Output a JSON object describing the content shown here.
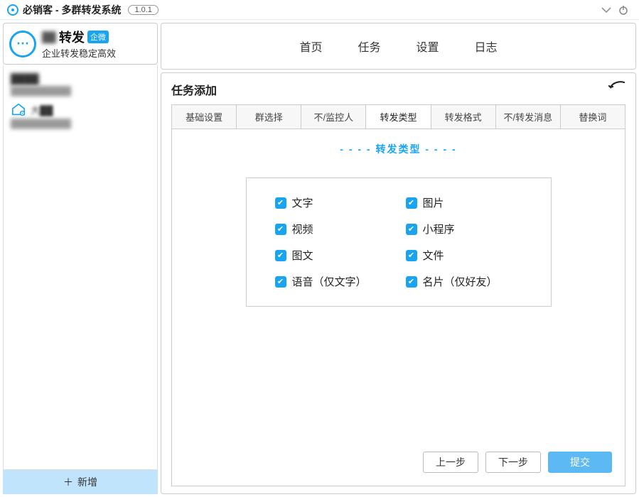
{
  "app": {
    "title": "必销客 - 多群转发系统",
    "version": "1.0.1"
  },
  "brand": {
    "main": "转发",
    "badge": "企微",
    "sub": "企业转发稳定高效"
  },
  "account": {
    "name": "████",
    "line": "██████████",
    "sub_name": "大██",
    "sub_line": "██████████"
  },
  "sidebar": {
    "add_label": "新增"
  },
  "nav": {
    "items": [
      "首页",
      "任务",
      "设置",
      "日志"
    ]
  },
  "content": {
    "title": "任务添加",
    "subtabs": [
      "基础设置",
      "群选择",
      "不/监控人",
      "转发类型",
      "转发格式",
      "不/转发消息",
      "替换词"
    ],
    "active_subtab_index": 3,
    "panel_title": "- - - -  转发类型  - - - -",
    "checks": [
      {
        "label": "文字",
        "checked": true
      },
      {
        "label": "图片",
        "checked": true
      },
      {
        "label": "视频",
        "checked": true
      },
      {
        "label": "小程序",
        "checked": true
      },
      {
        "label": "图文",
        "checked": true
      },
      {
        "label": "文件",
        "checked": true
      },
      {
        "label": "语音（仅文字）",
        "checked": true
      },
      {
        "label": "名片（仅好友）",
        "checked": true
      }
    ],
    "buttons": {
      "prev": "上一步",
      "next": "下一步",
      "submit": "提交"
    }
  }
}
